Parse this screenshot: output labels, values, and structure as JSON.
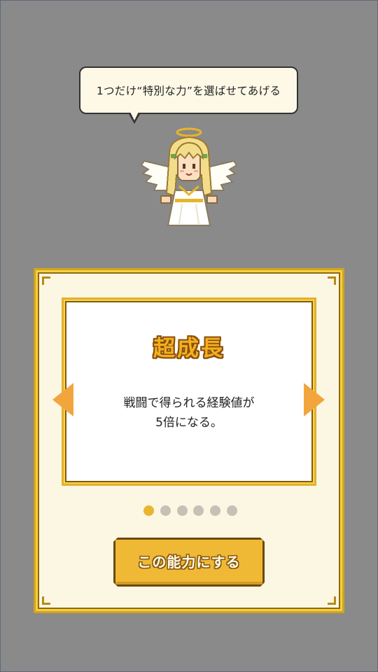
{
  "dialogue": {
    "message": "1つだけ“特別な力”を選ばせてあげる"
  },
  "ability_card": {
    "name": "超成長",
    "description_line1": "戦闘で得られる経験値が",
    "description_line2": "5倍になる。"
  },
  "pagination": {
    "total_pages": 6,
    "current_page": 1
  },
  "confirm_button": {
    "label": "この能力にする"
  },
  "colors": {
    "background": "#8a8a8a",
    "panel_gold": "#f6cf3f",
    "panel_cream": "#fcf7e2",
    "accent_orange": "#f2a53c",
    "title_gold": "#f2b020",
    "dot_active": "#e7b530",
    "dot_inactive": "#c4c1b6"
  },
  "icons": {
    "prev": "arrow-left-icon",
    "next": "arrow-right-icon",
    "character": "angel-sprite"
  }
}
